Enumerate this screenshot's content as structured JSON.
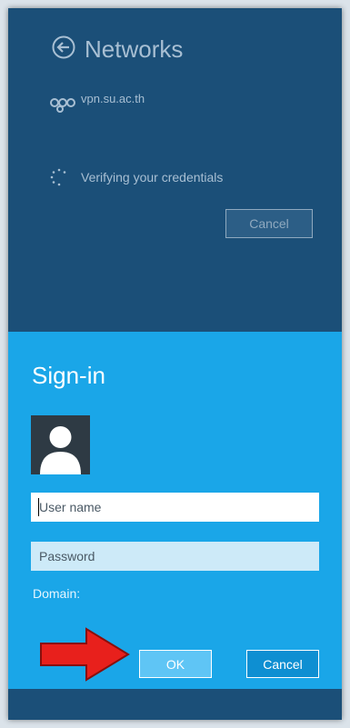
{
  "header": {
    "title": "Networks",
    "back_icon": "back-arrow-circle-icon"
  },
  "connection": {
    "name": "vpn.su.ac.th",
    "icon": "vpn-network-icon",
    "status_icon": "loading-spinner-icon",
    "status": "Verifying your credentials",
    "cancel_label": "Cancel"
  },
  "signin": {
    "title": "Sign-in",
    "avatar_icon": "user-avatar-icon",
    "username_placeholder": "User name",
    "password_placeholder": "Password",
    "domain_label": "Domain:",
    "ok_label": "OK",
    "cancel_label": "Cancel"
  },
  "annotation": {
    "arrow_icon": "red-arrow-icon"
  },
  "colors": {
    "top_background": "#1b4f78",
    "panel_background": "#1aa6e8",
    "arrow": "#e8201c"
  }
}
